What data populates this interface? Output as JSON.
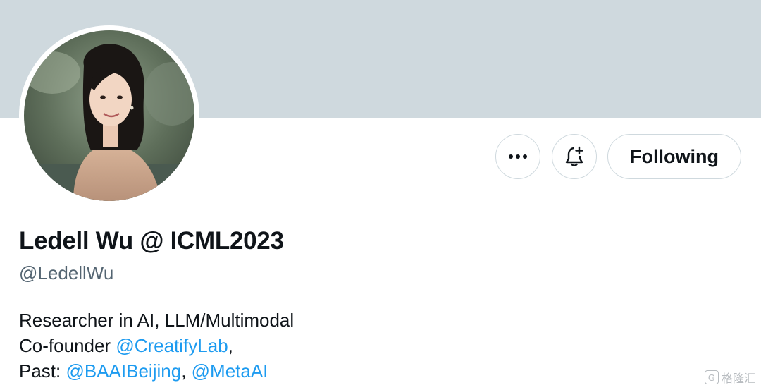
{
  "profile": {
    "display_name": "Ledell Wu @ ICML2023",
    "handle": "@LedellWu"
  },
  "actions": {
    "more_icon": "more-horizontal-icon",
    "notify_icon": "bell-plus-icon",
    "follow_label": "Following"
  },
  "bio": {
    "line1": "Researcher in AI, LLM/Multimodal",
    "line2_prefix": "Co-founder ",
    "line2_mention": "@CreatifyLab",
    "line2_suffix": ",",
    "line3_prefix": "Past: ",
    "line3_mention1": "@BAAIBeijing",
    "line3_sep": ", ",
    "line3_mention2": "@MetaAI"
  },
  "watermark": {
    "text": "格隆汇"
  },
  "colors": {
    "banner": "#cfd9de",
    "link": "#1d9bf0",
    "secondary_text": "#536471",
    "primary_text": "#0f1419"
  }
}
